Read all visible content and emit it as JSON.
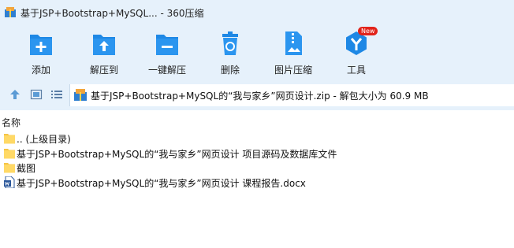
{
  "window": {
    "title": "基于JSP+Bootstrap+MySQL... - 360压缩"
  },
  "toolbar": {
    "buttons": [
      {
        "label": "添加",
        "icon": "add-icon"
      },
      {
        "label": "解压到",
        "icon": "extract-to-icon"
      },
      {
        "label": "一键解压",
        "icon": "one-click-extract-icon"
      },
      {
        "label": "删除",
        "icon": "delete-icon"
      },
      {
        "label": "图片压缩",
        "icon": "image-compress-icon"
      },
      {
        "label": "工具",
        "icon": "tools-icon",
        "badge": "New"
      }
    ]
  },
  "addressbar": {
    "path": "基于JSP+Bootstrap+MySQL的“我与家乡”网页设计.zip - 解包大小为 60.9 MB"
  },
  "list": {
    "header_name": "名称",
    "rows": [
      {
        "name": ".. (上级目录)",
        "type": "folder"
      },
      {
        "name": "基于JSP+Bootstrap+MySQL的“我与家乡”网页设计 项目源码及数据库文件",
        "type": "folder"
      },
      {
        "name": "截图",
        "type": "folder"
      },
      {
        "name": "基于JSP+Bootstrap+MySQL的“我与家乡”网页设计 课程报告.docx",
        "type": "docx"
      }
    ]
  },
  "colors": {
    "chrome_bg": "#e6f1fb",
    "accent_blue": "#1e88e5",
    "folder_yellow": "#f5c445",
    "badge_red": "#e2231a"
  }
}
